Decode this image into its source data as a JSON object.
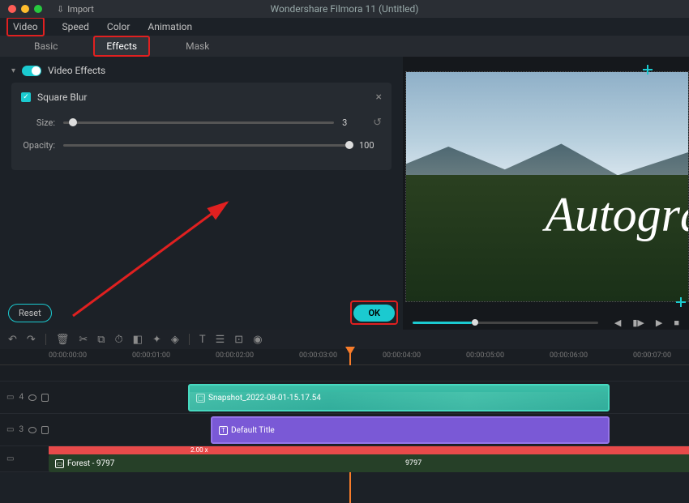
{
  "app": {
    "title": "Wondershare Filmora 11 (Untitled)",
    "import_label": "Import"
  },
  "main_tabs": {
    "video": "Video",
    "speed": "Speed",
    "color": "Color",
    "animation": "Animation"
  },
  "sub_tabs": {
    "basic": "Basic",
    "effects": "Effects",
    "mask": "Mask"
  },
  "panel": {
    "video_effects": "Video Effects",
    "square_blur": "Square Blur",
    "size_label": "Size:",
    "size_value": "3",
    "opacity_label": "Opacity:",
    "opacity_value": "100"
  },
  "buttons": {
    "reset": "Reset",
    "ok": "OK"
  },
  "preview": {
    "overlay_text": "Autogra"
  },
  "timeline": {
    "ticks": [
      "00:00:00:00",
      "00:00:01:00",
      "00:00:02:00",
      "00:00:03:00",
      "00:00:04:00",
      "00:00:05:00",
      "00:00:06:00",
      "00:00:07:00"
    ],
    "clip_snapshot": "Snapshot_2022-08-01-15.17.54",
    "clip_title": "Default Title",
    "clip_forest": "Forest - 9797",
    "forest_marker": "9797",
    "speed": "2.00 x"
  },
  "tracks": {
    "t4": "4",
    "t3": "3"
  }
}
